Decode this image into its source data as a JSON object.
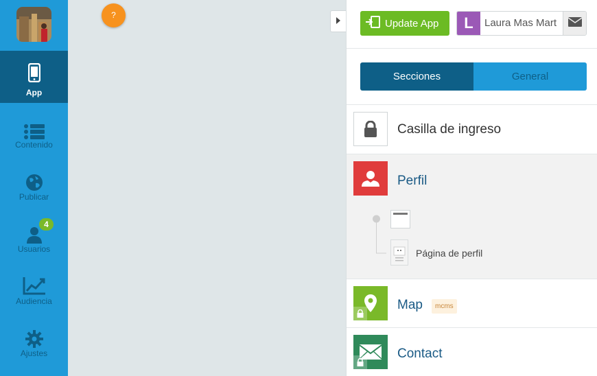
{
  "sidebar": {
    "items": [
      {
        "label": "App",
        "icon": "smartphone-icon"
      },
      {
        "label": "Contenido",
        "icon": "list-icon"
      },
      {
        "label": "Publicar",
        "icon": "globe-icon"
      },
      {
        "label": "Usuarios",
        "icon": "user-icon",
        "badge": "4"
      },
      {
        "label": "Audiencia",
        "icon": "line-chart-icon"
      },
      {
        "label": "Ajustes",
        "icon": "gear-icon"
      }
    ]
  },
  "canvas": {
    "help_label": "?"
  },
  "topbar": {
    "update_label": "Update App",
    "user_initial": "L",
    "user_name": "Laura Mas Mart"
  },
  "tabs": [
    {
      "label": "Secciones",
      "active": true
    },
    {
      "label": "General",
      "active": false
    }
  ],
  "sections": [
    {
      "label": "Casilla de ingreso",
      "icon": "lock-icon"
    },
    {
      "label": "Perfil",
      "icon": "person-icon",
      "color": "#e03c3c",
      "children": [
        {
          "label": ""
        },
        {
          "label": "Página de perfil"
        }
      ]
    },
    {
      "label": "Map",
      "icon": "map-pin-icon",
      "color": "#7ab929",
      "tag": "mcms",
      "locked": true
    },
    {
      "label": "Contact",
      "icon": "envelope-icon",
      "color": "#2f8a5a",
      "locked": true
    }
  ],
  "colors": {
    "sidebar": "#1f9ad8",
    "sidebar_active": "#0e5f87",
    "update_button": "#6cbb24",
    "avatar": "#9b59b6",
    "help_button": "#f7921e"
  }
}
